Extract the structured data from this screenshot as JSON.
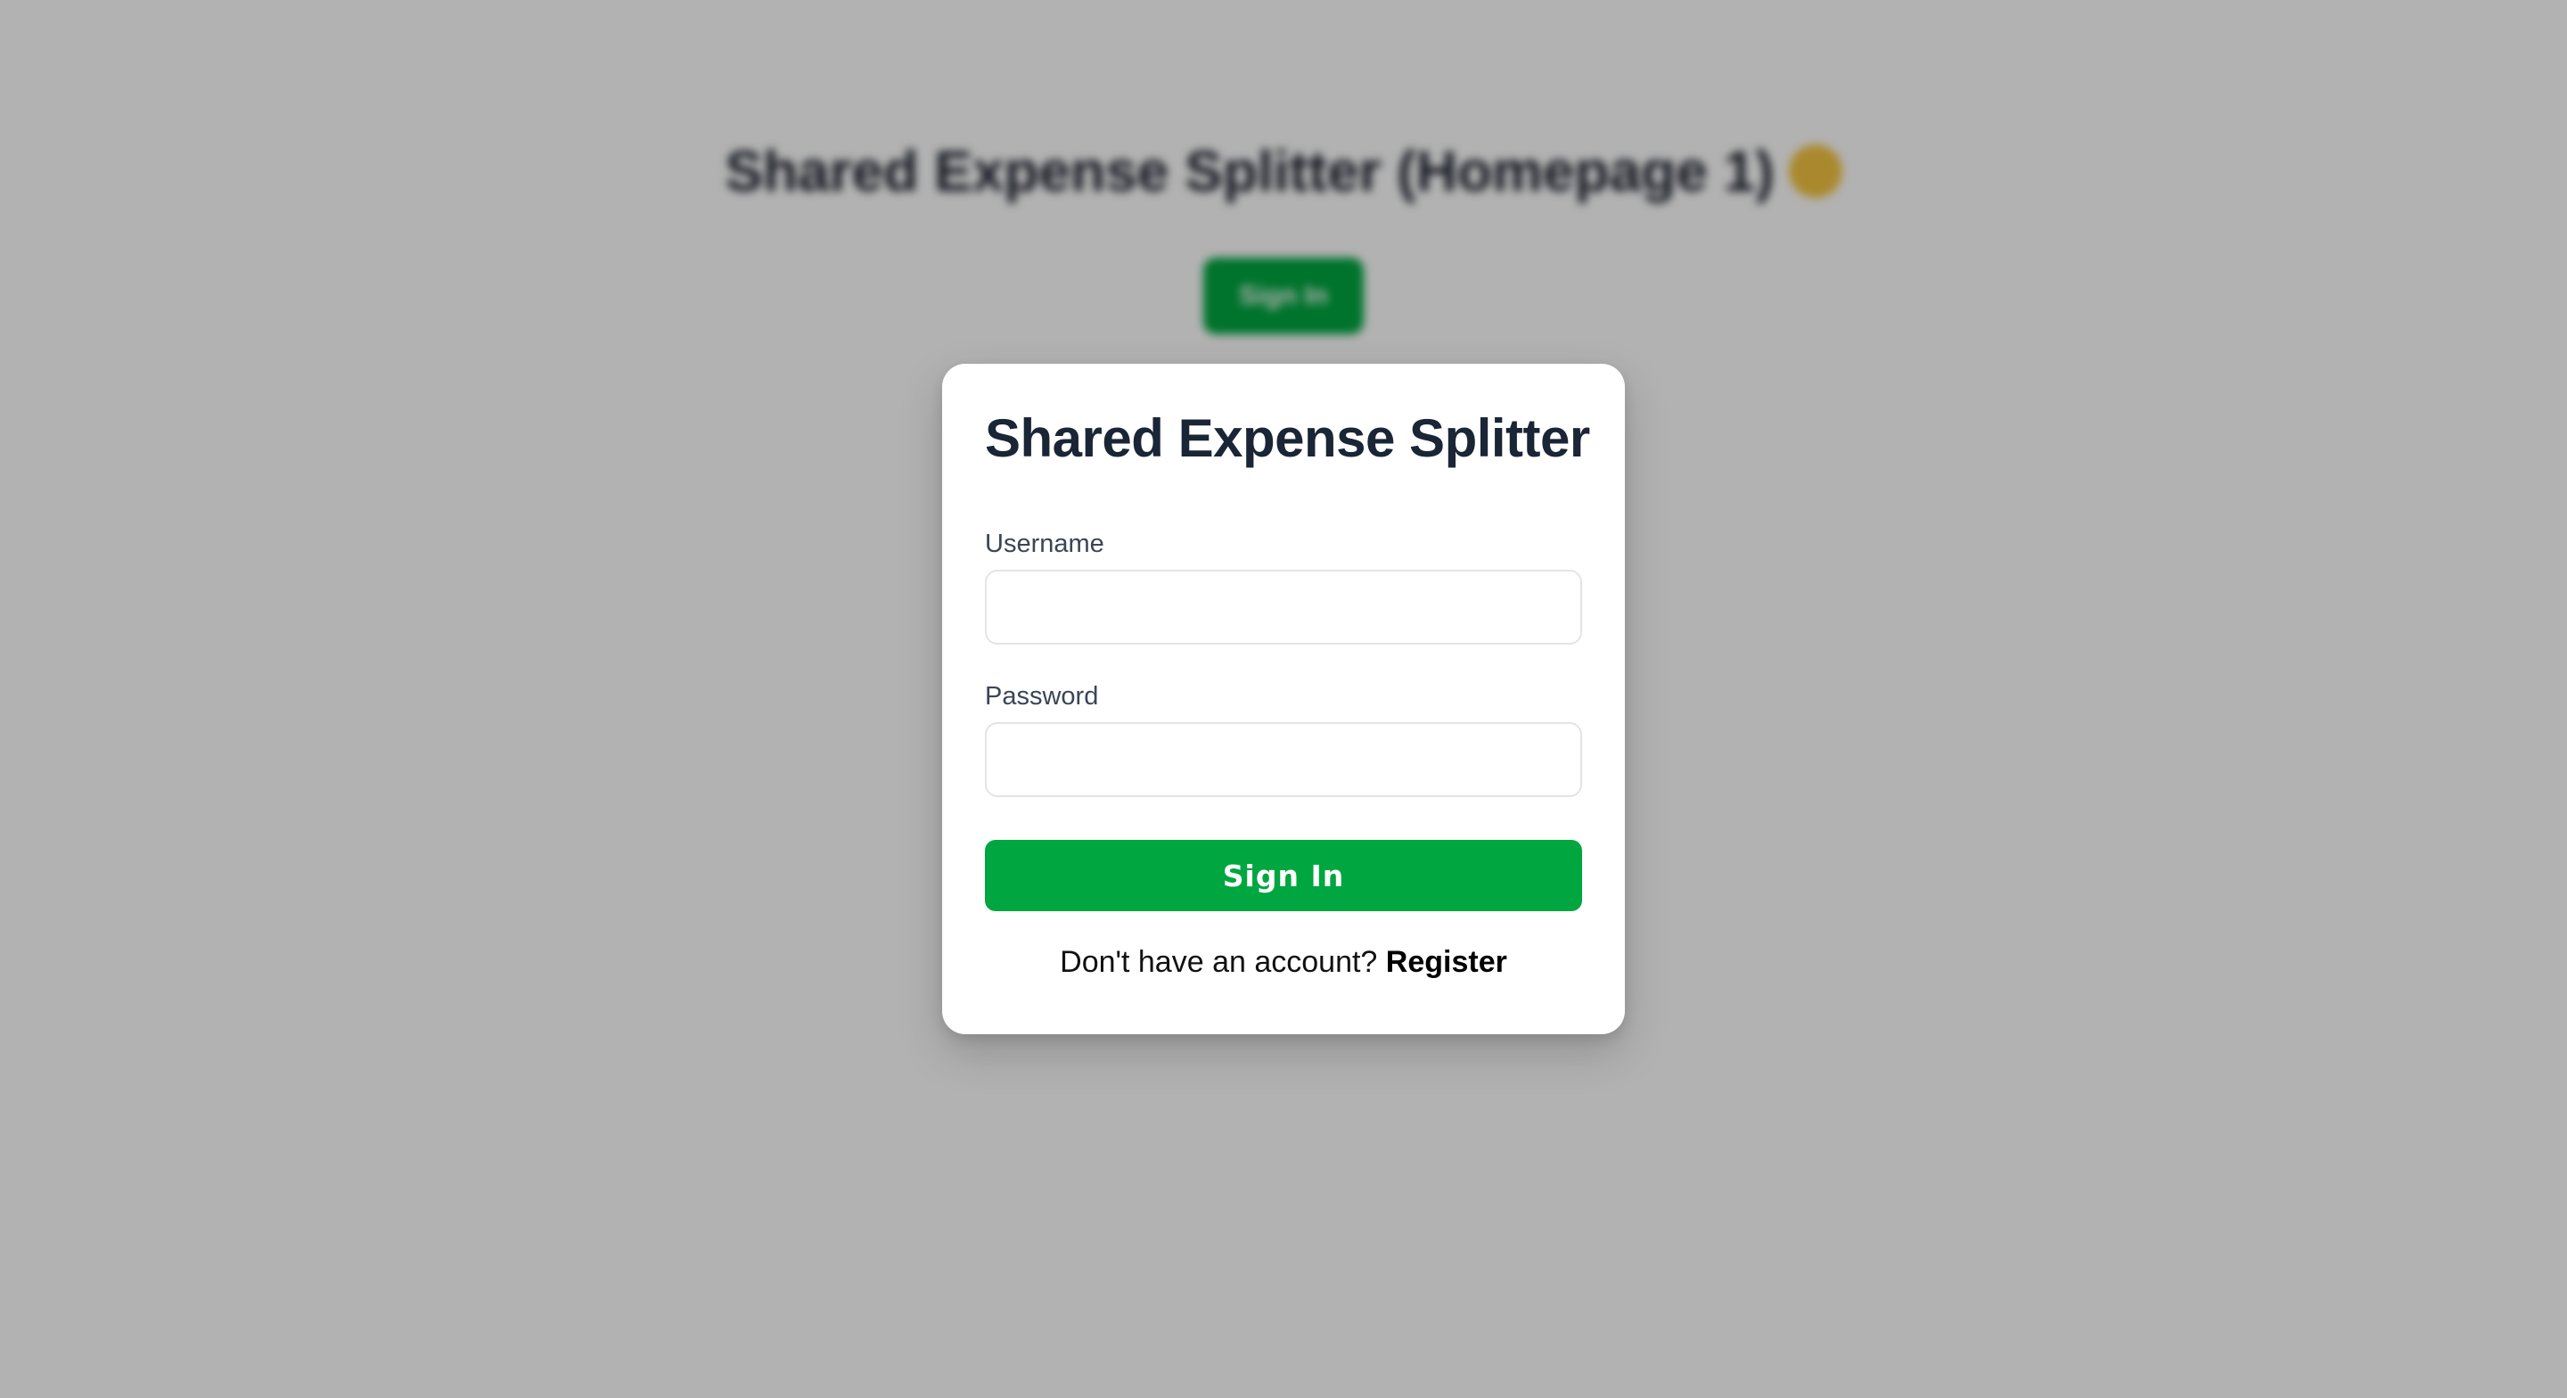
{
  "background": {
    "heading": "Shared Expense Splitter (Homepage 1)",
    "emoji_icon": "smiley-emoji-icon",
    "button_label": "Sign In"
  },
  "login_card": {
    "title": "Shared Expense Splitter",
    "username_label": "Username",
    "username_value": "",
    "password_label": "Password",
    "password_value": "",
    "signin_label": "Sign In",
    "register_prompt": "Don't have an account?",
    "register_link": "Register"
  },
  "colors": {
    "accent": "#00a640",
    "title_text": "#1a2536",
    "overlay": "rgba(0,0,0,0.30)"
  }
}
